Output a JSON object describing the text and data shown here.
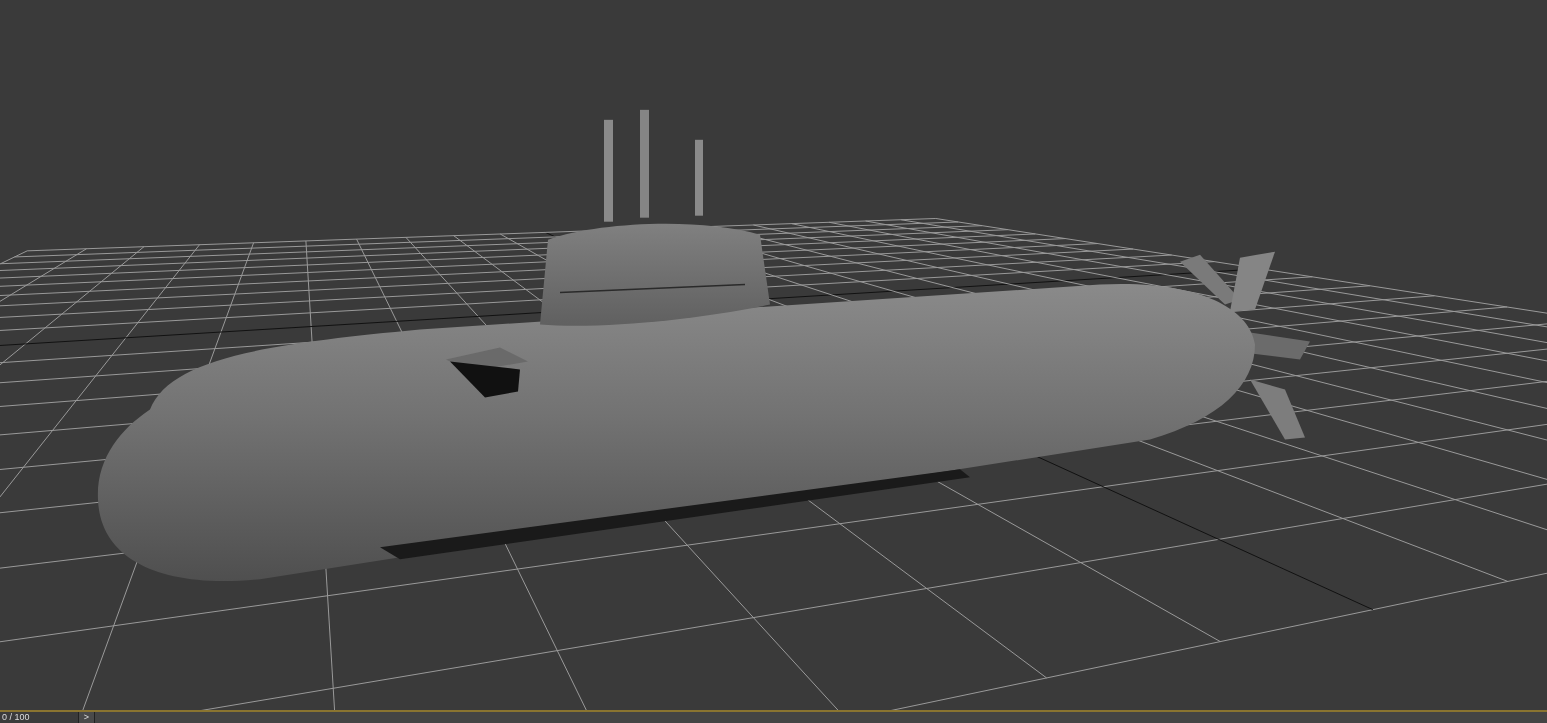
{
  "timeline": {
    "frame_label": "0 / 100",
    "next_button": ">",
    "level": 0
  }
}
